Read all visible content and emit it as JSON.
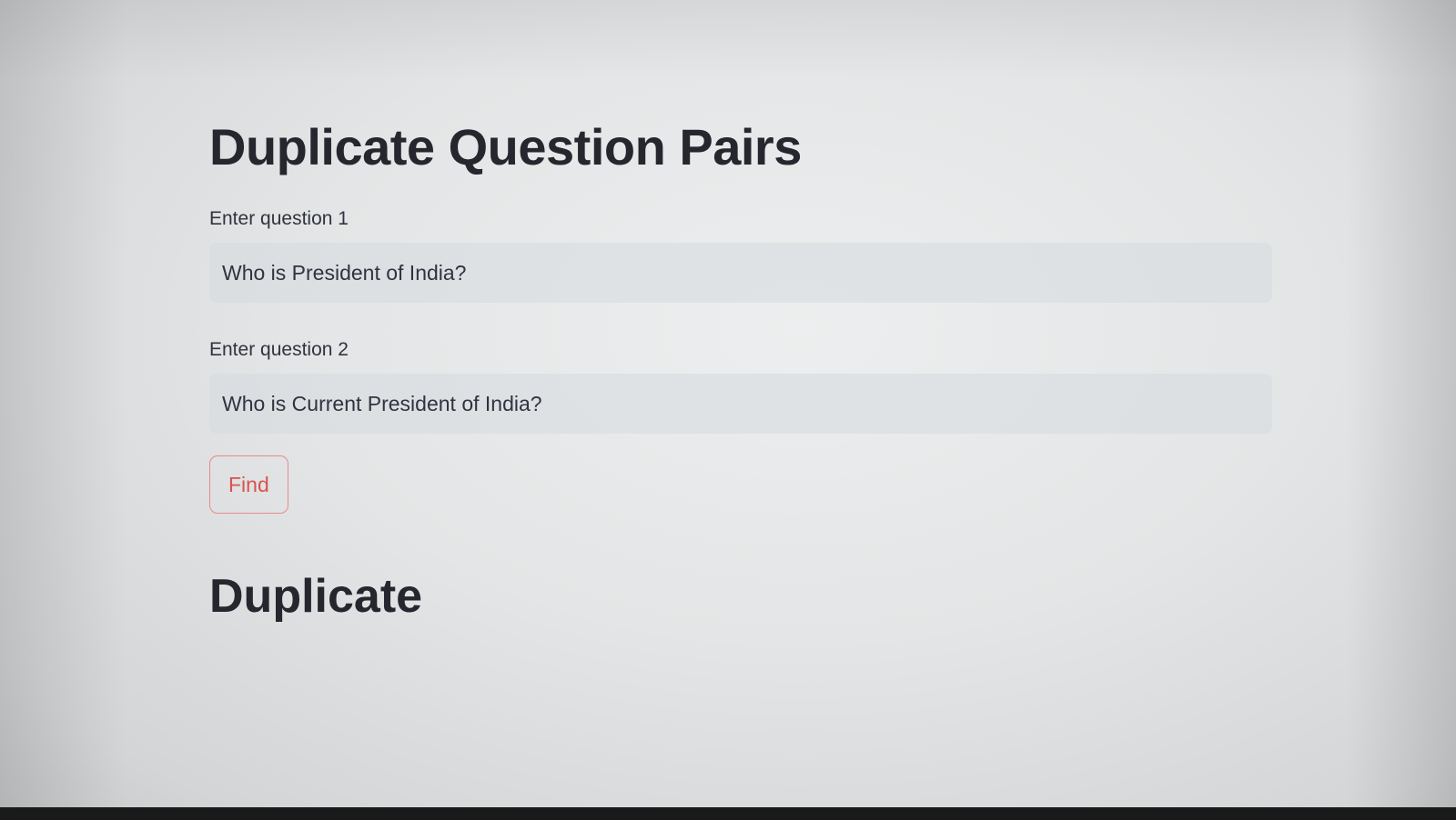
{
  "app": {
    "title": "Duplicate Question Pairs"
  },
  "form": {
    "question1": {
      "label": "Enter question 1",
      "value": "Who is President of India?"
    },
    "question2": {
      "label": "Enter question 2",
      "value": "Who is Current President of India?"
    },
    "find_button_label": "Find"
  },
  "result": {
    "text": "Duplicate"
  },
  "colors": {
    "button_text": "#d9534f",
    "button_border": "#e88b8b",
    "input_background": "#dcdfe2",
    "text": "#26272e"
  }
}
